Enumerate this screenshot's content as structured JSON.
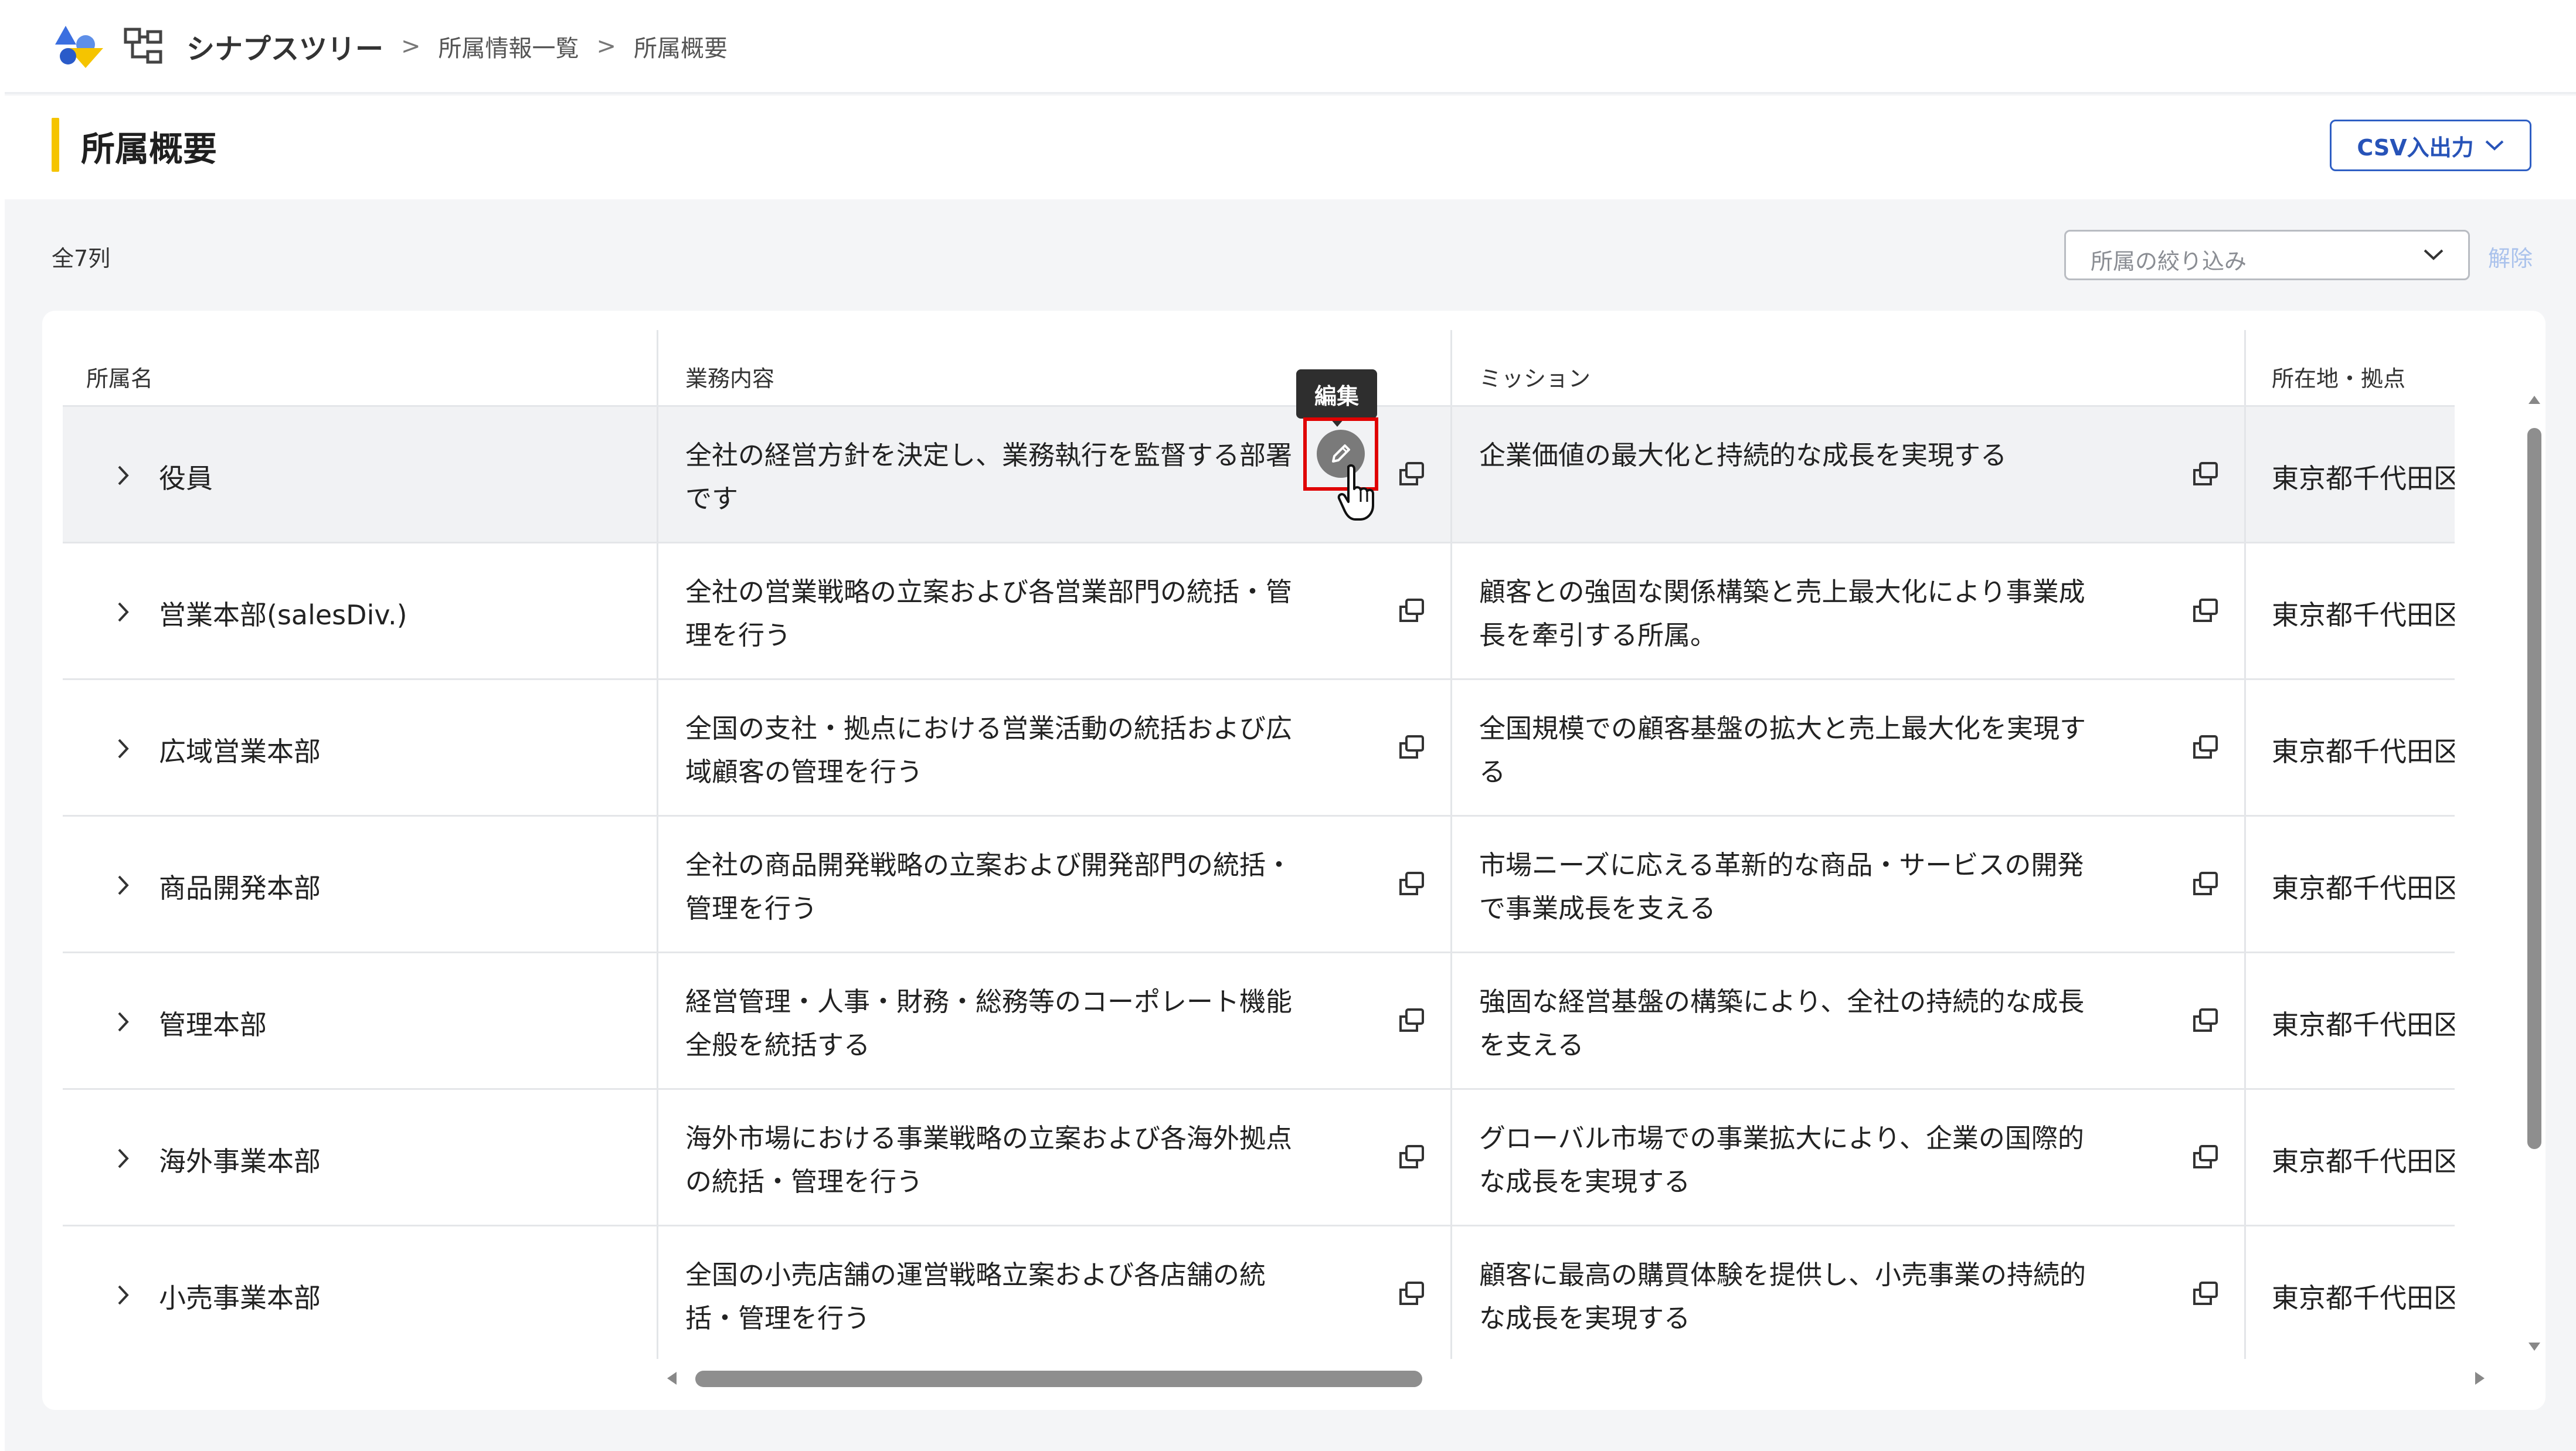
{
  "header": {
    "app_name": "シナプスツリー",
    "breadcrumb": [
      "所属情報一覧",
      "所属概要"
    ],
    "separator": ">"
  },
  "page": {
    "title": "所属概要",
    "csv_button": "CSV入出力",
    "count": "全7列",
    "filter_placeholder": "所属の絞り込み",
    "clear_label": "解除"
  },
  "table": {
    "columns": [
      "所属名",
      "業務内容",
      "ミッション",
      "所在地・拠点"
    ],
    "rows": [
      {
        "name": "役員",
        "desc": "全社の経営方針を決定し、業務執行を監督する部署です",
        "mission": "企業価値の最大化と持続的な成長を実現する",
        "location": "東京都千代田区東京"
      },
      {
        "name": "営業本部(salesDiv.)",
        "desc": "全社の営業戦略の立案および各営業部門の統括・管理を行う",
        "mission": "顧客との強固な関係構築と売上最大化により事業成長を牽引する所属。",
        "location": "東京都千代田区東京"
      },
      {
        "name": "広域営業本部",
        "desc": "全国の支社・拠点における営業活動の統括および広域顧客の管理を行う",
        "mission": "全国規模での顧客基盤の拡大と売上最大化を実現する",
        "location": "東京都千代田区東京"
      },
      {
        "name": "商品開発本部",
        "desc": "全社の商品開発戦略の立案および開発部門の統括・管理を行う",
        "mission": "市場ニーズに応える革新的な商品・サービスの開発で事業成長を支える",
        "location": "東京都千代田区東京"
      },
      {
        "name": "管理本部",
        "desc": "経営管理・人事・財務・総務等のコーポレート機能全般を統括する",
        "mission": "強固な経営基盤の構築により、全社の持続的な成長を支える",
        "location": "東京都千代田区東京"
      },
      {
        "name": "海外事業本部",
        "desc": "海外市場における事業戦略の立案および各海外拠点の統括・管理を行う",
        "mission": "グローバル市場での事業拡大により、企業の国際的な成長を実現する",
        "location": "東京都千代田区東京"
      },
      {
        "name": "小売事業本部",
        "desc": "全国の小売店舗の運営戦略立案および各店舗の統括・管理を行う",
        "mission": "顧客に最高の購買体験を提供し、小売事業の持続的な成長を実現する",
        "location": "東京都千代田区東京"
      }
    ]
  },
  "tooltip": {
    "edit": "編集"
  },
  "colors": {
    "accent": "#f5c400",
    "primary": "#2f5fc4",
    "highlight": "#e00000"
  }
}
